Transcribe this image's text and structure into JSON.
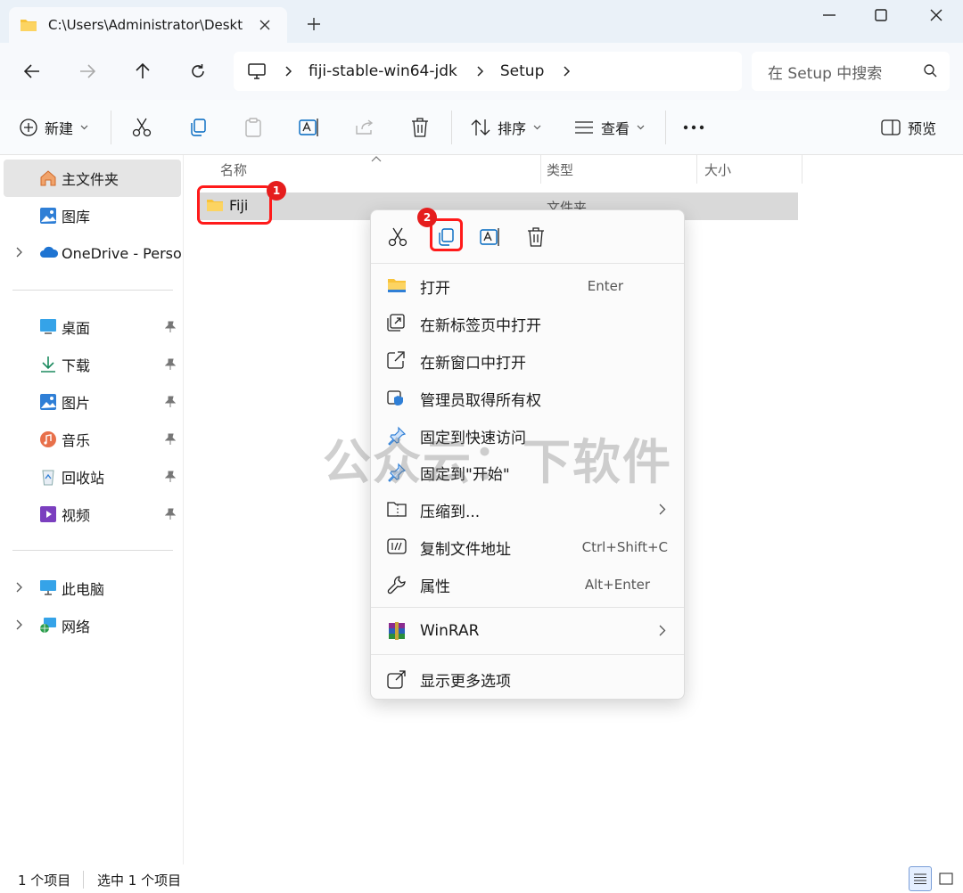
{
  "window": {
    "tab_title": "C:\\Users\\Administrator\\Desktop",
    "colors": {
      "titlebar": "#eaf1f8",
      "accent": "#0067c0",
      "highlight": "#ff1a1a"
    }
  },
  "address": {
    "crumbs": [
      "fiji-stable-win64-jdk",
      "Setup"
    ],
    "search_placeholder": "在 Setup 中搜索"
  },
  "toolbar": {
    "new_label": "新建",
    "sort_label": "排序",
    "view_label": "查看",
    "preview_label": "预览"
  },
  "sidebar": {
    "items": [
      {
        "label": "主文件夹"
      },
      {
        "label": "图库"
      },
      {
        "label": "OneDrive - Personal"
      },
      {
        "label": "桌面"
      },
      {
        "label": "下载"
      },
      {
        "label": "图片"
      },
      {
        "label": "音乐"
      },
      {
        "label": "回收站"
      },
      {
        "label": "视频"
      },
      {
        "label": "此电脑"
      },
      {
        "label": "网络"
      }
    ]
  },
  "content": {
    "columns": [
      "名称",
      "类型",
      "大小"
    ],
    "rows": [
      {
        "name": "Fiji",
        "type": "文件夹"
      }
    ]
  },
  "annotations": {
    "badge1": "1",
    "badge2": "2"
  },
  "context_menu": {
    "items": [
      {
        "label": "打开",
        "shortcut": "Enter"
      },
      {
        "label": "在新标签页中打开"
      },
      {
        "label": "在新窗口中打开"
      },
      {
        "label": "管理员取得所有权"
      },
      {
        "label": "固定到快速访问"
      },
      {
        "label": "固定到\"开始\""
      },
      {
        "label": "压缩到..."
      },
      {
        "label": "复制文件地址",
        "shortcut": "Ctrl+Shift+C"
      },
      {
        "label": "属性",
        "shortcut": "Alt+Enter"
      },
      {
        "label": "WinRAR"
      },
      {
        "label": "显示更多选项"
      }
    ]
  },
  "status": {
    "count": "1 个项目",
    "selected": "选中 1 个项目"
  },
  "watermark": "公众云：下软件"
}
